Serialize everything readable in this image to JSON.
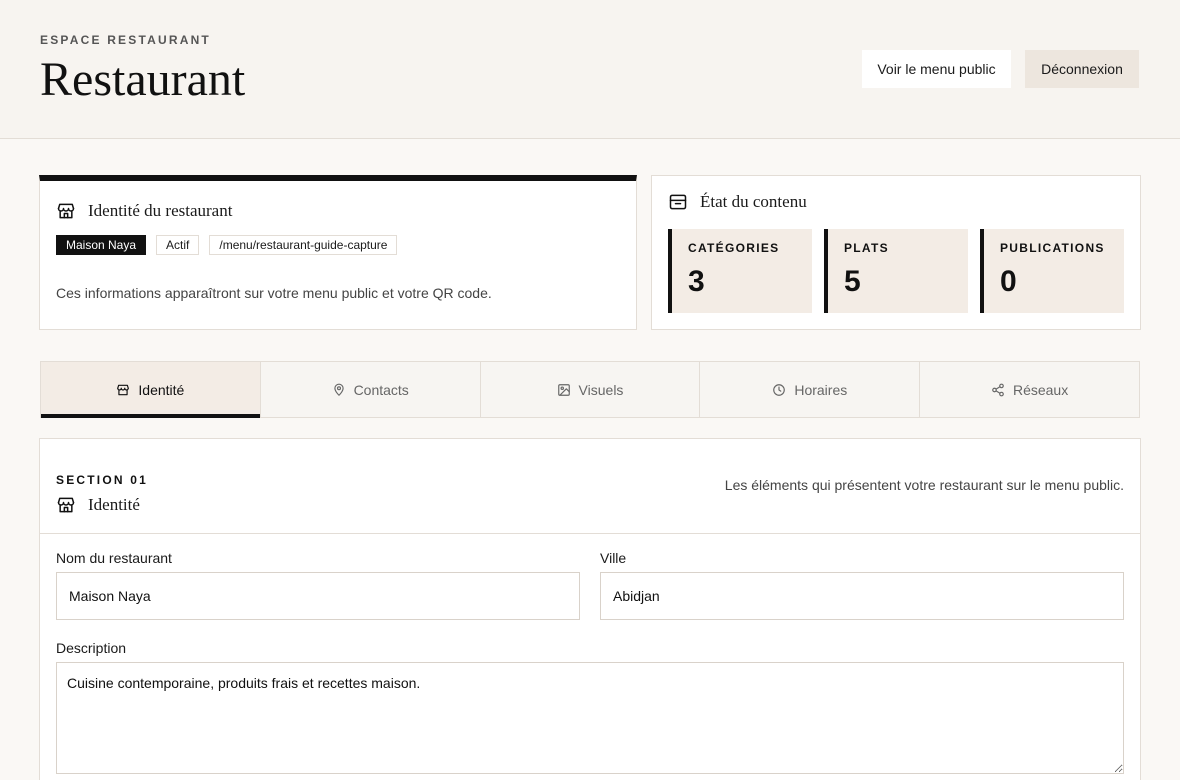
{
  "header": {
    "eyebrow": "ESPACE RESTAURANT",
    "title": "Restaurant",
    "public_menu_label": "Voir le menu public",
    "logout_label": "Déconnexion"
  },
  "identity_card": {
    "title": "Identité du restaurant",
    "icon": "store-icon",
    "badges": [
      "Maison Naya",
      "Actif",
      "/menu/restaurant-guide-capture"
    ],
    "description": "Ces informations apparaîtront sur votre menu public et votre QR code."
  },
  "status_card": {
    "title": "État du contenu",
    "icon": "inbox-icon",
    "stats": [
      {
        "label": "CATÉGORIES",
        "value": "3"
      },
      {
        "label": "PLATS",
        "value": "5"
      },
      {
        "label": "PUBLICATIONS",
        "value": "0"
      }
    ]
  },
  "tabs": [
    {
      "label": "Identité",
      "icon": "store-icon",
      "active": true
    },
    {
      "label": "Contacts",
      "icon": "map-pin-icon",
      "active": false
    },
    {
      "label": "Visuels",
      "icon": "image-icon",
      "active": false
    },
    {
      "label": "Horaires",
      "icon": "clock-icon",
      "active": false
    },
    {
      "label": "Réseaux",
      "icon": "share-icon",
      "active": false
    }
  ],
  "section": {
    "eyebrow": "SECTION 01",
    "title": "Identité",
    "note": "Les éléments qui présentent votre restaurant sur le menu public.",
    "fields": {
      "name": {
        "label": "Nom du restaurant",
        "value": "Maison Naya"
      },
      "city": {
        "label": "Ville",
        "value": "Abidjan"
      },
      "description": {
        "label": "Description",
        "value": "Cuisine contemporaine, produits frais et recettes maison."
      }
    }
  },
  "colors": {
    "accent": "#111111",
    "beige": "#f3ece5",
    "background": "#faf8f5"
  }
}
